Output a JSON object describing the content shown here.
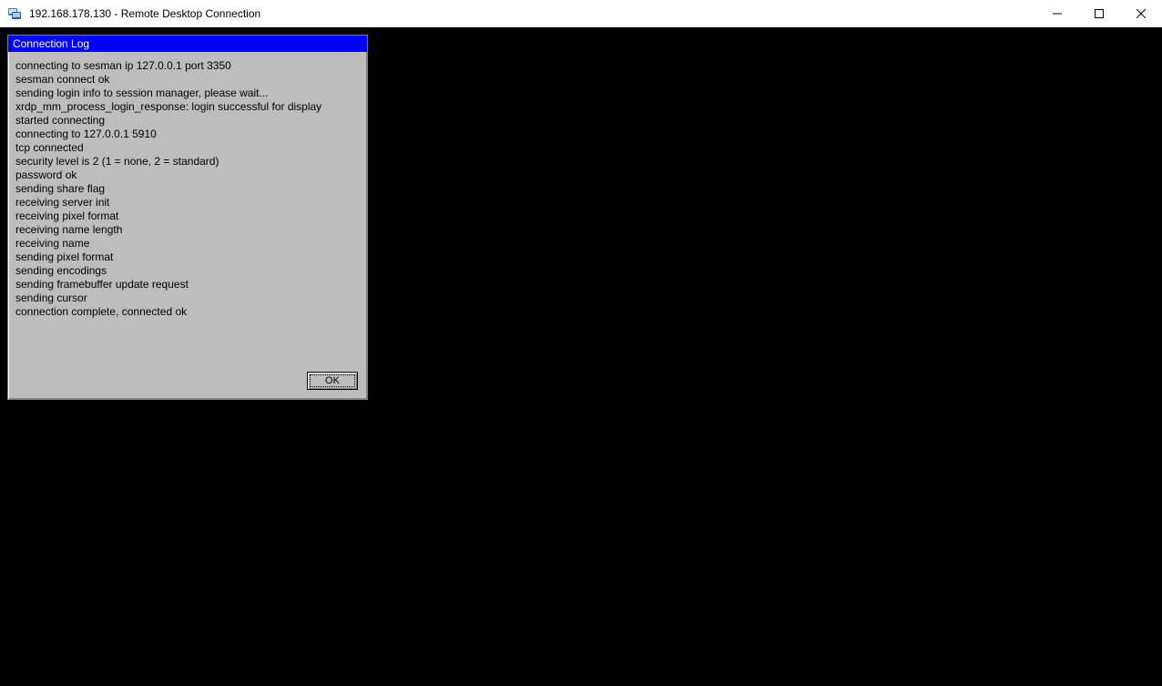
{
  "window": {
    "title": "192.168.178.130 - Remote Desktop Connection"
  },
  "dialog": {
    "title": "Connection Log",
    "ok_label": "OK",
    "log_lines": [
      "connecting to sesman ip 127.0.0.1 port 3350",
      "sesman connect ok",
      "sending login info to session manager, please wait...",
      "xrdp_mm_process_login_response: login successful for display",
      "started connecting",
      "connecting to 127.0.0.1 5910",
      "tcp connected",
      "security level is 2 (1 = none, 2 = standard)",
      "password ok",
      "sending share flag",
      "receiving server init",
      "receiving pixel format",
      "receiving name length",
      "receiving name",
      "sending pixel format",
      "sending encodings",
      "sending framebuffer update request",
      "sending cursor",
      "connection complete, connected ok"
    ]
  }
}
